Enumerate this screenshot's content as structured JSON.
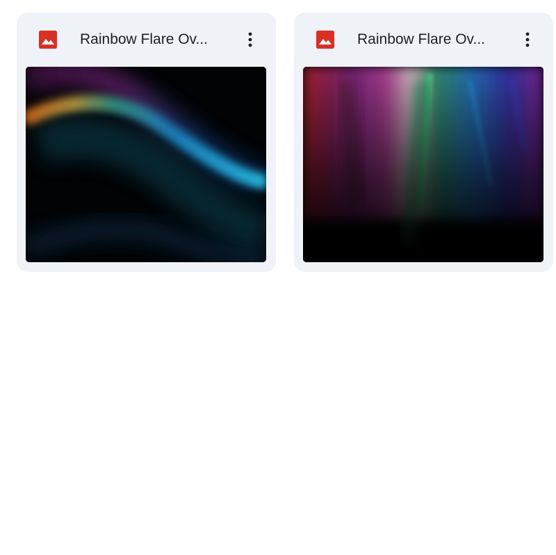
{
  "files": [
    {
      "title": "Rainbow Flare Ov...",
      "icon": "image-icon",
      "icon_color": "#d93025",
      "more_icon": "more-vert-icon",
      "thumbnail": "rainbow-wave-thumbnail"
    },
    {
      "title": "Rainbow Flare Ov...",
      "icon": "image-icon",
      "icon_color": "#d93025",
      "more_icon": "more-vert-icon",
      "thumbnail": "rainbow-streaks-thumbnail"
    }
  ]
}
